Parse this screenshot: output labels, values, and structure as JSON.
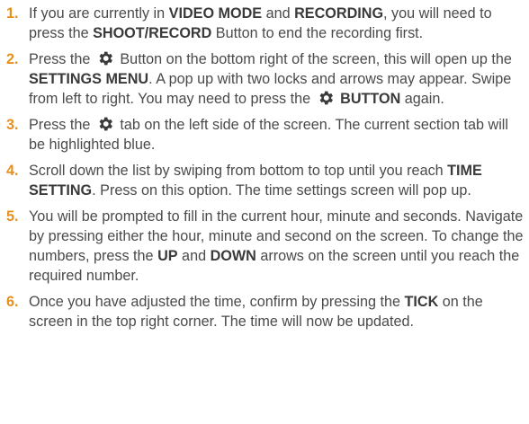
{
  "steps": [
    {
      "number": "1.",
      "parts": [
        "If you are currently in ",
        "VIDEO MODE",
        " and ",
        "RECORDING",
        ", you will need to press the ",
        "SHOOT/RECORD",
        " Button to end the recording first."
      ]
    },
    {
      "number": "2.",
      "parts": [
        "Press the ",
        " Button on the bottom right of the screen, this will open up the ",
        "SETTINGS MENU",
        ". A pop up with two locks and arrows may appear. Swipe from left to right. You may need to press the ",
        "BUTTON",
        " again."
      ]
    },
    {
      "number": "3.",
      "parts": [
        "Press the ",
        " tab on the left side of the screen. The current section tab will be highlighted blue."
      ]
    },
    {
      "number": "4.",
      "parts": [
        "Scroll down the list  by swiping from bottom to top until you reach ",
        "TIME SETTING",
        ". Press on this option. The time settings screen will pop up."
      ]
    },
    {
      "number": "5.",
      "parts": [
        "You will be prompted to fill in the current hour, minute and seconds. Navigate by pressing either the hour, minute and second on the screen. To change the numbers, press the ",
        "UP",
        " and ",
        "DOWN",
        " arrows on the screen until you reach the required number."
      ]
    },
    {
      "number": "6.",
      "parts": [
        "Once you have adjusted the time, confirm by pressing the ",
        "TICK",
        " on the screen in the top right corner. The time will now be updated."
      ]
    }
  ],
  "icons": {
    "gear": "gear-icon"
  },
  "colors": {
    "number": "#e8901f",
    "text": "#4a4a4a",
    "icon": "#3a3a3a"
  }
}
